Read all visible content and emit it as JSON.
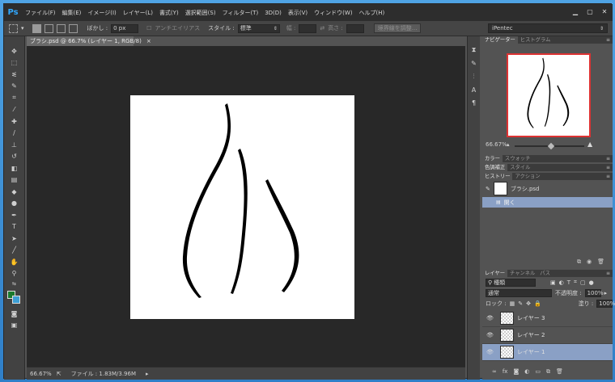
{
  "app": {
    "logo": "Ps"
  },
  "menu": [
    "ファイル(F)",
    "編集(E)",
    "イメージ(I)",
    "レイヤー(L)",
    "書式(Y)",
    "選択範囲(S)",
    "フィルター(T)",
    "3D(D)",
    "表示(V)",
    "ウィンドウ(W)",
    "ヘルプ(H)"
  ],
  "options": {
    "feather_label": "ぼかし :",
    "feather_value": "0 px",
    "antialias": "アンチエイリアス",
    "style_label": "スタイル :",
    "style_value": "標準",
    "width_label": "幅 :",
    "height_label": "高さ :",
    "refine_edge": "境界線を調整...",
    "workspace": "iPentec"
  },
  "document": {
    "tab_title": "ブラシ.psd @ 66.7% (レイヤー 1, RGB/8)",
    "close": "×",
    "zoom": "66.67%",
    "file_info": "ファイル : 1.83M/3.96M"
  },
  "navigator": {
    "tab": "ナビゲーター",
    "tab2": "ヒストグラム",
    "zoom": "66.67%"
  },
  "color_panel": {
    "tab": "カラー",
    "tab2": "スウォッチ"
  },
  "adjust_panel": {
    "tab": "色調補正",
    "tab2": "スタイル"
  },
  "history": {
    "tab": "ヒストリー",
    "tab2": "アクション",
    "snapshot": "ブラシ.psd",
    "items": [
      "開く"
    ]
  },
  "layers": {
    "tab": "レイヤー",
    "tab2": "チャンネル",
    "tab3": "パス",
    "filter": "種類",
    "blend_mode": "通常",
    "opacity_label": "不透明度 :",
    "opacity": "100%",
    "lock_label": "ロック :",
    "fill_label": "塗り :",
    "fill": "100%",
    "items": [
      "レイヤー 3",
      "レイヤー 2",
      "レイヤー 1"
    ]
  },
  "colors": {
    "foreground": "#1a7a2e",
    "background": "#3d9fd5",
    "selection": "#8aa0c5",
    "accent": "#31a8ff"
  }
}
